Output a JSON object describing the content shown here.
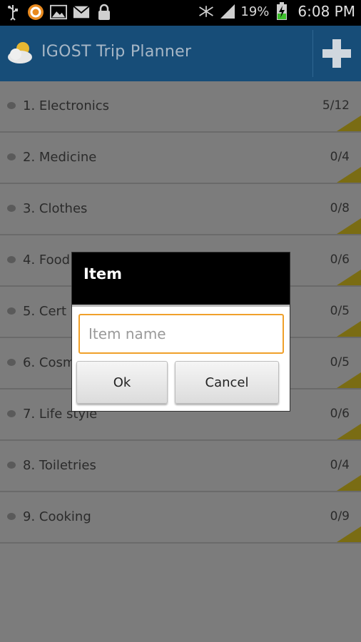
{
  "status_bar": {
    "battery": "19%",
    "time": "6:08 PM",
    "icons": [
      "usb-icon",
      "browser-notification-icon",
      "image-icon",
      "email-icon",
      "lock-icon",
      "wifi-off-icon",
      "signal-icon",
      "battery-charging-icon"
    ]
  },
  "action_bar": {
    "title": "IGOST Trip Planner",
    "add_icon": "plus-icon",
    "accent": "#174d78"
  },
  "categories": [
    {
      "label": "1. Electronics",
      "count": "5/12"
    },
    {
      "label": "2. Medicine",
      "count": "0/4"
    },
    {
      "label": "3. Clothes",
      "count": "0/8"
    },
    {
      "label": "4. Food",
      "count": "0/6"
    },
    {
      "label": "5. Cert",
      "count": "0/5"
    },
    {
      "label": "6. Cosm",
      "count": "0/5"
    },
    {
      "label": "7. Life style",
      "count": "0/6"
    },
    {
      "label": "8. Toiletries",
      "count": "0/4"
    },
    {
      "label": "9. Cooking",
      "count": "0/9"
    }
  ],
  "dialog": {
    "title": "Item",
    "input_value": "",
    "input_placeholder": "Item name",
    "ok_label": "Ok",
    "cancel_label": "Cancel",
    "input_focus_color": "#f0a02a"
  }
}
